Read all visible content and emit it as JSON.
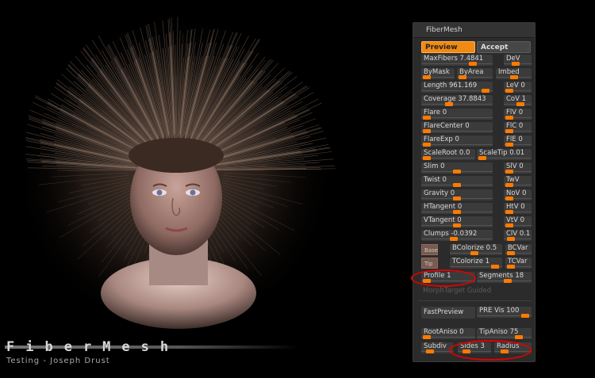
{
  "viewport": {
    "brand": "FiberMesh",
    "subtitle": "Testing - Joseph Drust"
  },
  "panel": {
    "title": "FiberMesh",
    "preview_label": "Preview",
    "accept_label": "Accept",
    "sliders": {
      "maxfibers": "MaxFibers 7.4841",
      "dev": "DeV",
      "bymask": "ByMask",
      "byarea": "ByArea",
      "imbed": "Imbed",
      "length": "Length 961.169",
      "lev": "LeV 0",
      "coverage": "Coverage 37.8843",
      "cov": "CoV 1",
      "flare": "Flare 0",
      "flv": "FlV 0",
      "flarecenter": "FlareCenter 0",
      "flc": "FlC 0",
      "flareexp": "FlareExp 0",
      "fle": "FlE 0",
      "scaleroot": "ScaleRoot 0.0",
      "scaletip": "ScaleTip 0.01",
      "slim": "Slim 0",
      "slv": "SlV 0",
      "twist": "Twist 0",
      "twv": "TwV",
      "gravity": "Gravity 0",
      "nov": "NoV 0",
      "htangent": "HTangent 0",
      "htv": "HtV 0",
      "vtangent": "VTangent 0",
      "vtv": "VtV 0",
      "clumps": "Clumps -0.0392",
      "clv": "ClV 0.1",
      "bcolorize": "BColorize 0.5",
      "bcvar": "BCVar",
      "tcolorize": "TColorize 1",
      "tcvar": "TCVar",
      "profile": "Profile 1",
      "segments": "Segments 18",
      "rootaniso": "RootAniso 0",
      "tipaniso": "TipAniso 75",
      "subdiv": "Subdiv",
      "sides": "Sides 3",
      "radius": "Radius"
    },
    "base_label": "Base",
    "tip_label": "Tip",
    "morph_label": "MorphTarget Guided",
    "fastpreview_label": "FastPreview",
    "previs_label": "PRE Vis 100"
  }
}
